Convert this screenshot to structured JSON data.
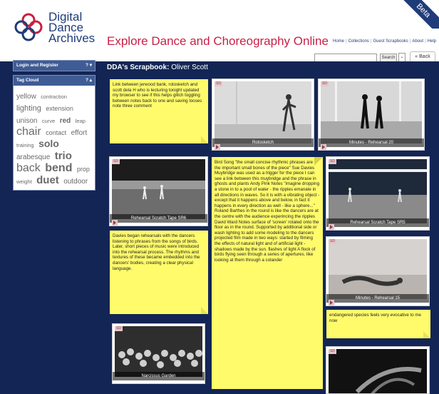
{
  "header": {
    "logo_lines": [
      "Digital",
      "Dance",
      "Archives"
    ],
    "headline": "Explore Dance and Choreography Online",
    "beta": "Beta",
    "nav": [
      "Home",
      "Collections",
      "Guest Scrapbooks",
      "About",
      "Help"
    ],
    "search_placeholder": "",
    "search_button": "Search",
    "back_button": "« Back"
  },
  "sidebar": {
    "login_panel": {
      "title": "Login and Register",
      "controls": "? ▾"
    },
    "tag_panel": {
      "title": "Tag Cloud",
      "controls": "? ▴"
    },
    "tags": [
      {
        "text": "yellow",
        "size": 10,
        "weight": "normal"
      },
      {
        "text": "contraction",
        "size": 7.5,
        "weight": "normal"
      },
      {
        "text": "lighting",
        "size": 11,
        "weight": "normal"
      },
      {
        "text": "extension",
        "size": 9,
        "weight": "normal"
      },
      {
        "text": "unison",
        "size": 10,
        "weight": "normal"
      },
      {
        "text": "curve",
        "size": 7.5,
        "weight": "normal"
      },
      {
        "text": "red",
        "size": 10,
        "weight": "bold"
      },
      {
        "text": "leap",
        "size": 7.5,
        "weight": "normal"
      },
      {
        "text": "chair",
        "size": 16,
        "weight": "normal"
      },
      {
        "text": "contact",
        "size": 9,
        "weight": "normal"
      },
      {
        "text": "effort",
        "size": 10,
        "weight": "normal"
      },
      {
        "text": "training",
        "size": 7.5,
        "weight": "normal"
      },
      {
        "text": "solo",
        "size": 14,
        "weight": "bold"
      },
      {
        "text": "arabesque",
        "size": 10,
        "weight": "normal"
      },
      {
        "text": "trio",
        "size": 15,
        "weight": "bold"
      },
      {
        "text": "back",
        "size": 16,
        "weight": "normal"
      },
      {
        "text": "bend",
        "size": 16,
        "weight": "bold"
      },
      {
        "text": "prop",
        "size": 9,
        "weight": "normal"
      },
      {
        "text": "weight",
        "size": 7.5,
        "weight": "normal"
      },
      {
        "text": "duet",
        "size": 15,
        "weight": "bold"
      },
      {
        "text": "outdoor",
        "size": 10,
        "weight": "normal"
      }
    ]
  },
  "main": {
    "title_prefix": "DDA's Scrapbook:",
    "title_name": "Oliver Scott"
  },
  "badge": "SD",
  "notes": [
    "Link between jerwood bank, rotosketch and scott dela H who is lecturing tonight updated my browser to see if this helps glitch toggling between notes back to one and saving looses note three comment",
    "Bird Song \"the small concise rhythmic phrases are the important small bones of the piece\" Sue Davies Muybridge was used as a trigger for the piece I can see a link between this muybridge and the phrase in ghosts and plants Andy Pink Notes \"imagine dropping a stone in to a pool of water - the ripples emanate in all directions in waves. So it is with a vibrating object - except that it happens above and below, in fact it happens in every direction as well - like a sphere...\" Roland Barthes in the round is like the dancers are at the centre with the audience experincing the ripples David Ward Notes surface of 'screen' rotated onto the floor as in the round. Supported by additional side or wash lighting to add some modeling to the dancers projected film made in two ways: started by filming the effects of natural light and of artificial light - shadows made by the sun. flashes of light A flock of birds flying seen through a series of apertures. like looking at them through a colander",
    "Davies began rehearsals with the dancers listening to phrases from the songs of birds. Later, short pieces of music were introduced into the rehearsal process. The rhythms and textures of these became embedded into the dancers' bodies, creating a clear physical language.",
    "endangered species feels very evocative to me now"
  ],
  "cards": [
    {
      "caption": "Rotosketch"
    },
    {
      "caption": "Minutes - Rehearsal 20"
    },
    {
      "caption": "Rehearsal Scratch Tape SR6"
    },
    {
      "caption": "Rehearsal Scratch Tape SR5"
    },
    {
      "caption": "Minutes - Rehearsal 15"
    },
    {
      "caption": "Narcissus Garden"
    },
    {
      "caption": ""
    }
  ],
  "colors": {
    "background": "#132555",
    "note": "#fffb6b",
    "brand_blue": "#1f3c7a",
    "brand_red": "#c81f45"
  }
}
